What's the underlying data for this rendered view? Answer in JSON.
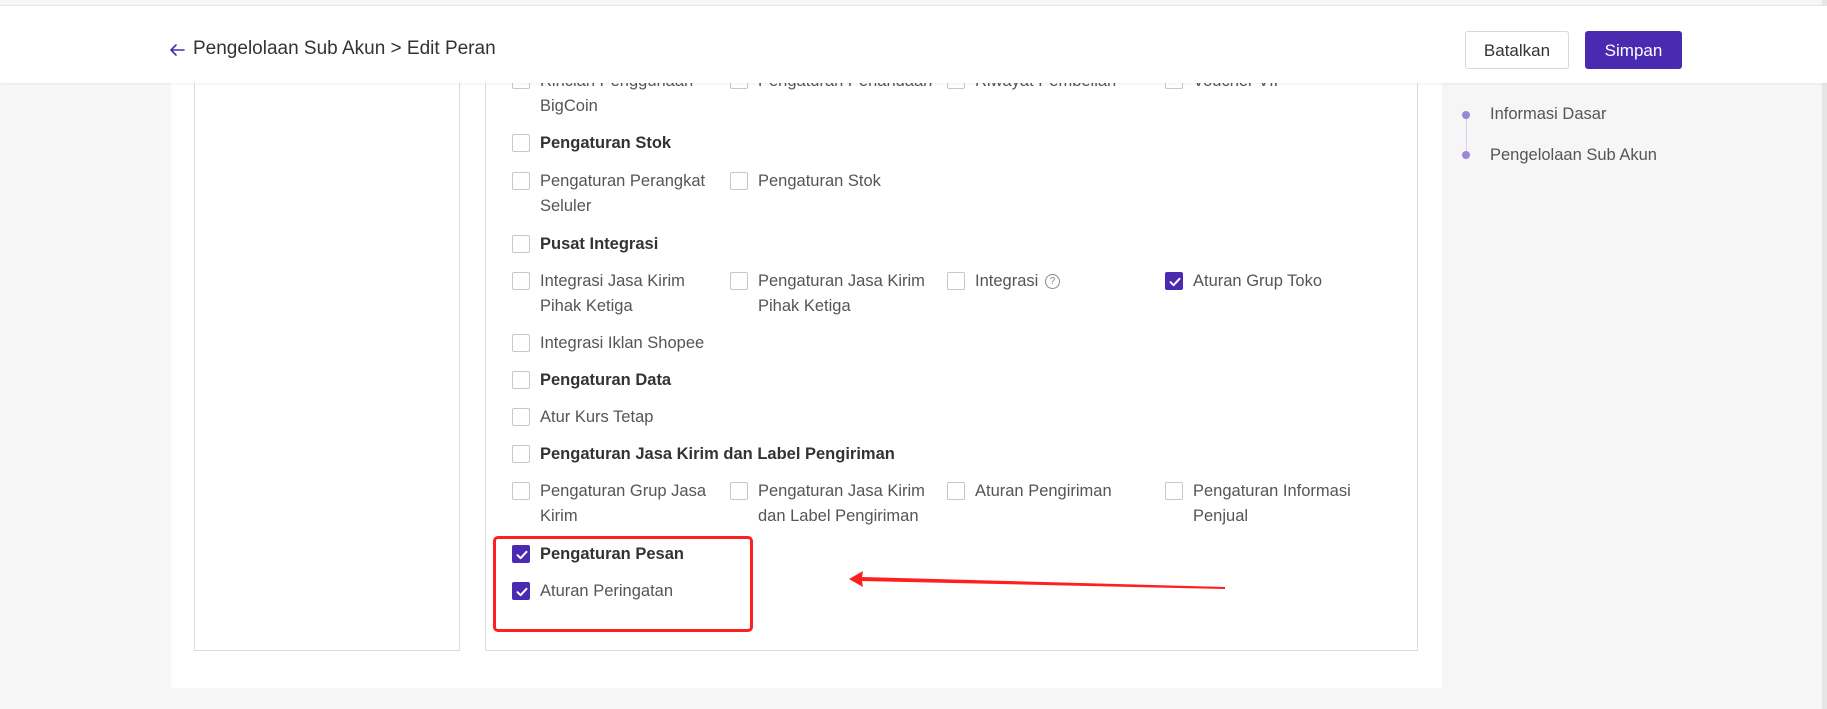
{
  "header": {
    "breadcrumb": "Pengelolaan Sub Akun > Edit Peran",
    "cancel_label": "Batalkan",
    "save_label": "Simpan"
  },
  "side_nav": {
    "items": [
      {
        "label": "Informasi Dasar"
      },
      {
        "label": "Pengelolaan Sub Akun"
      }
    ]
  },
  "permissions": {
    "rows": {
      "r0": {
        "c1": "Rincian Penggunaan",
        "c1b": "BigCoin",
        "c2": "Pengaturan Penandaan",
        "c3": "Riwayat Pembelian",
        "c4": "Voucher VIP"
      },
      "stok": {
        "heading": "Pengaturan Stok",
        "c1": "Pengaturan Perangkat",
        "c1b": "Seluler",
        "c2": "Pengaturan Stok"
      },
      "integrasi": {
        "heading": "Pusat Integrasi",
        "c1": "Integrasi Jasa Kirim",
        "c1b": "Pihak Ketiga",
        "c2": "Pengaturan Jasa Kirim",
        "c2b": "Pihak Ketiga",
        "c3": "Integrasi",
        "c4": "Aturan Grup Toko",
        "c5": "Integrasi Iklan Shopee"
      },
      "data": {
        "heading": "Pengaturan Data",
        "c1": "Atur Kurs Tetap"
      },
      "jasa": {
        "heading": "Pengaturan Jasa Kirim dan Label Pengiriman",
        "c1": "Pengaturan Grup Jasa",
        "c1b": "Kirim",
        "c2": "Pengaturan Jasa Kirim",
        "c2b": "dan Label Pengiriman",
        "c3": "Aturan Pengiriman",
        "c4": "Pengaturan Informasi",
        "c4b": "Penjual"
      },
      "pesan": {
        "heading": "Pengaturan Pesan",
        "c1": "Aturan Peringatan"
      }
    },
    "help_glyph": "?"
  },
  "colors": {
    "accent": "#4a2ab0",
    "annotation": "#ff1f1f",
    "side_dot": "#9b86d8"
  },
  "icons": {
    "back": "arrow-left-icon",
    "check": "check-icon",
    "help": "question-circle-icon"
  }
}
